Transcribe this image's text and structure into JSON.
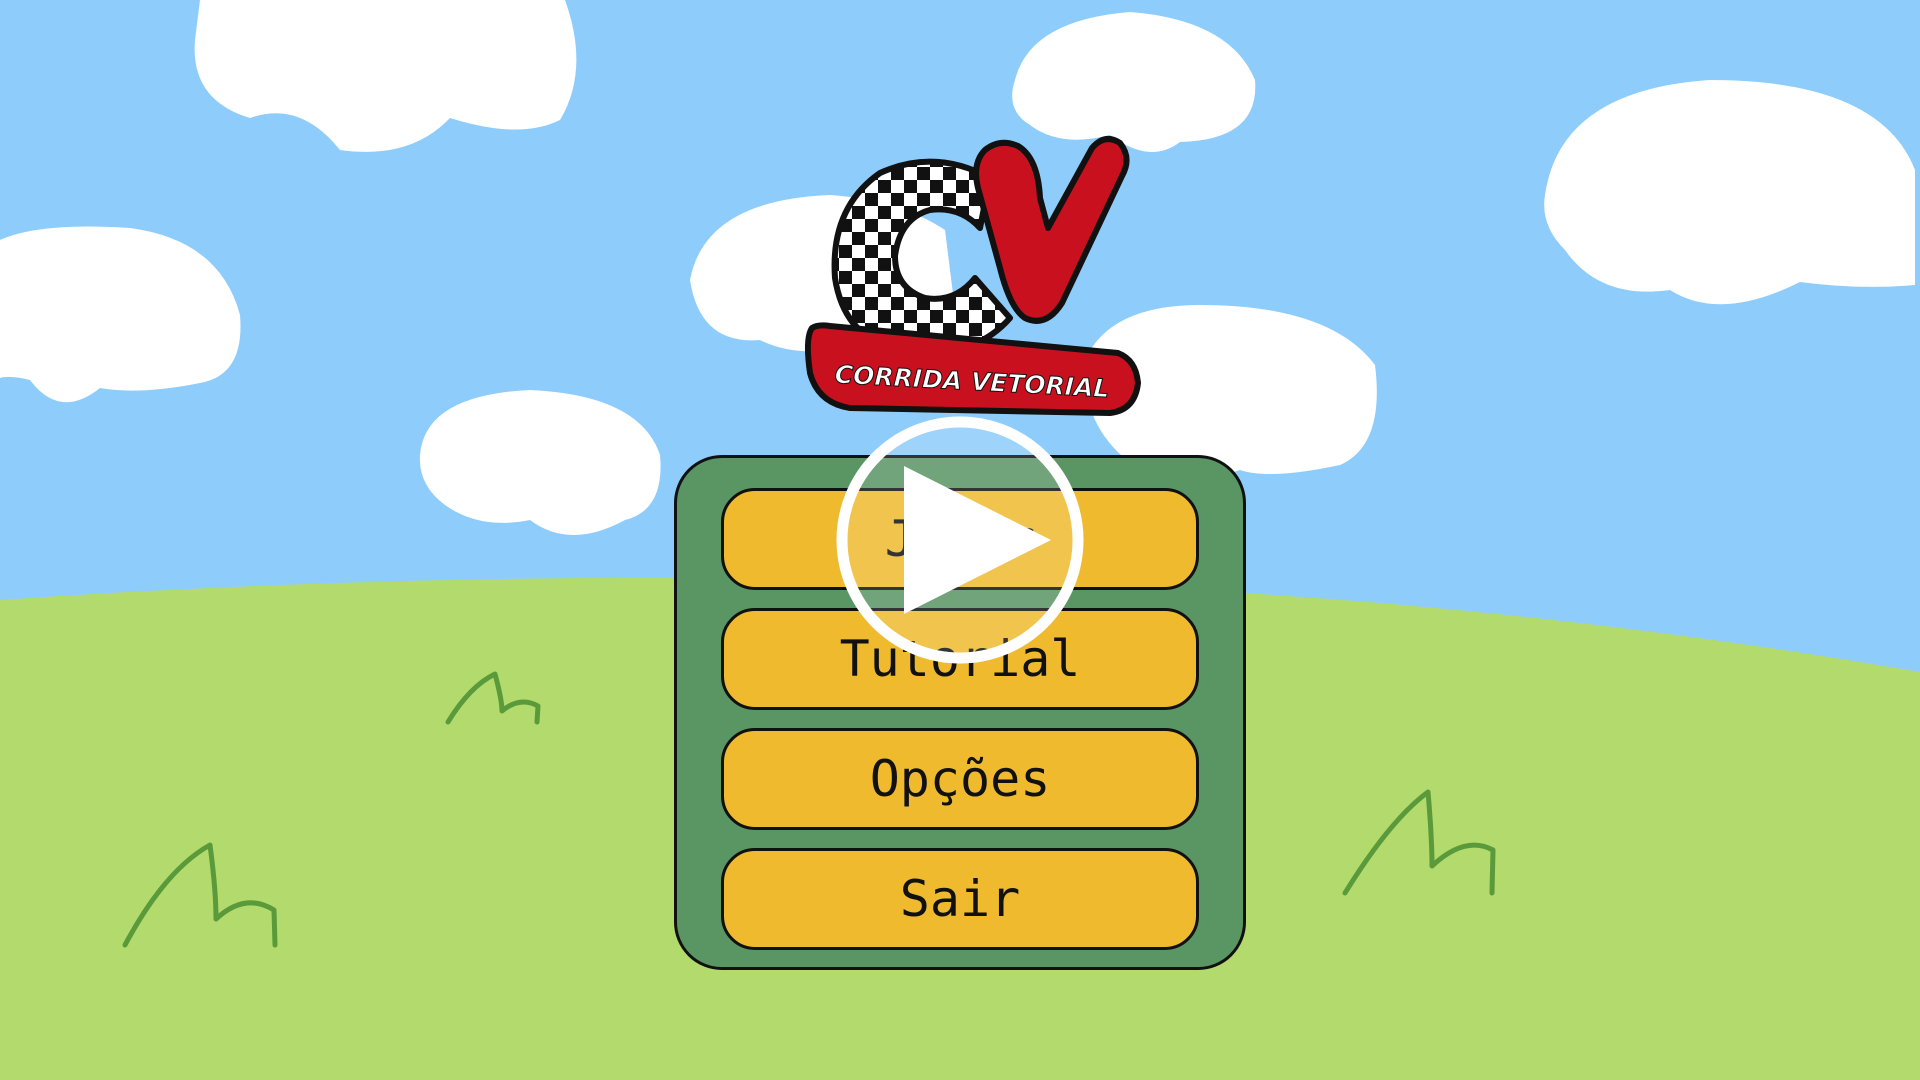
{
  "game": {
    "logo_text": "CORRIDA VETORIAL",
    "logo_icon": "checkered-flag-cv-logo"
  },
  "menu": {
    "items": [
      {
        "label": "Jogar"
      },
      {
        "label": "Tutorial"
      },
      {
        "label": "Opções"
      },
      {
        "label": "Sair"
      }
    ]
  },
  "overlay": {
    "icon": "play-icon"
  },
  "colors": {
    "sky": "#8ecdfb",
    "grass": "#b2da6d",
    "hill_sketch": "#5a9a3a",
    "cloud": "#ffffff",
    "panel": "#5a9564",
    "button": "#efba2e",
    "logo_red": "#c8101e",
    "outline": "#111111"
  }
}
